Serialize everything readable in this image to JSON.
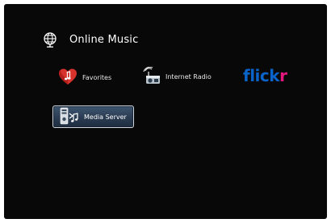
{
  "header": {
    "title": "Online Music",
    "icon": "globe-icon"
  },
  "menu": {
    "favorites": {
      "label": "Favorites",
      "icon": "heart-music-icon"
    },
    "internet_radio": {
      "label": "Internet Radio",
      "icon": "radio-tower-icon"
    },
    "flickr": {
      "logo_text_a": "flick",
      "logo_text_b": "r"
    },
    "media_server": {
      "label": "Media Server",
      "icon": "media-server-icon",
      "selected": true
    }
  },
  "colors": {
    "background": "#080808",
    "flickr_blue": "#0a63c9",
    "flickr_pink": "#e6187f",
    "selection_fill": "#2a3c52"
  }
}
